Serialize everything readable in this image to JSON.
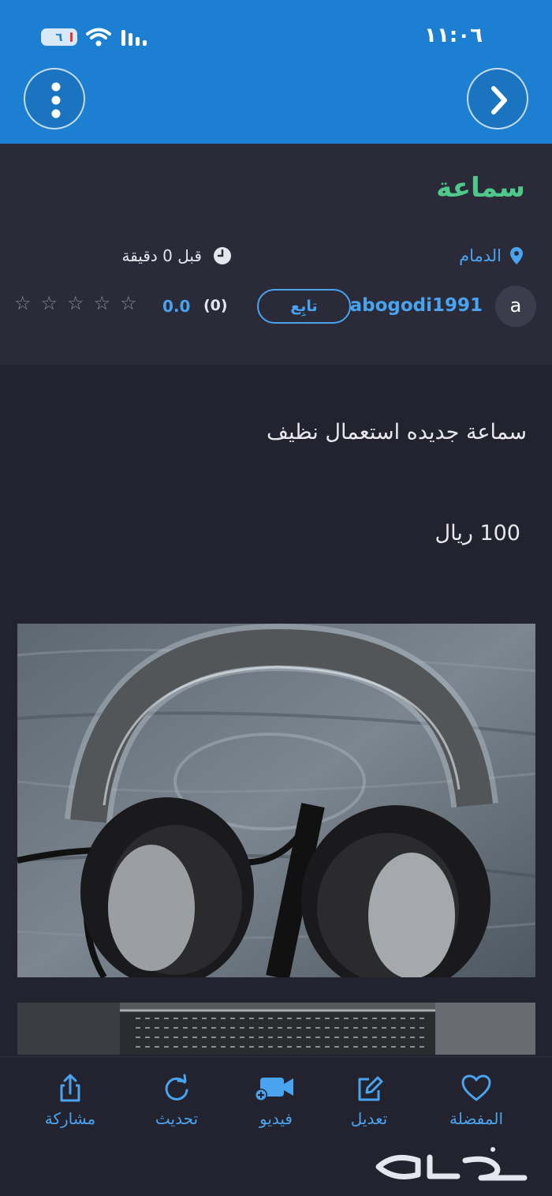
{
  "status_bar": {
    "time": "١١:٠٦",
    "battery": "٦"
  },
  "header": {
    "menu_icon": "more-vertical-icon",
    "back_icon": "chevron-right-icon"
  },
  "listing": {
    "title": "سماعة",
    "location": "الدمام",
    "time_ago": "قبل 0 دقيقة",
    "description": "سماعة جديده استعمال نظيف",
    "price": "100 ريال"
  },
  "seller": {
    "avatar_letter": "a",
    "username": "abogodi1991",
    "follow_label": "تابِع",
    "rating_count": "(0)",
    "rating_value": "0.0",
    "stars": 0
  },
  "bottom_bar": {
    "share": "مشاركة",
    "refresh": "تحديث",
    "video": "فيديو",
    "edit": "تعديل",
    "favorite": "المفضلة"
  },
  "brand": {
    "logo": "حراج"
  },
  "colors": {
    "header": "#1c7fd1",
    "accent": "#4aa3ef",
    "title": "#4fc98a",
    "background": "#23232f"
  }
}
